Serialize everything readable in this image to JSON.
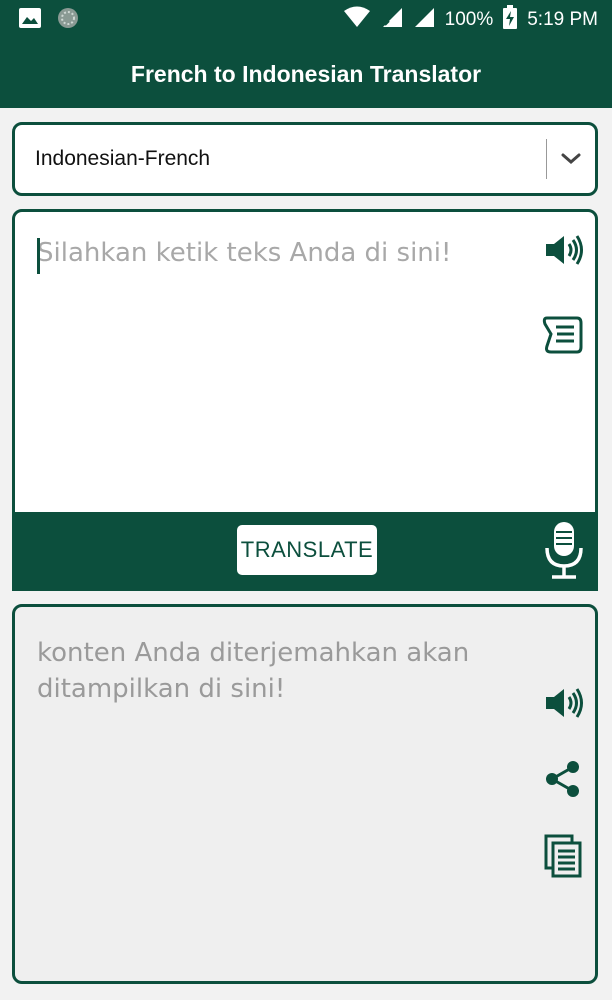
{
  "status_bar": {
    "battery": "100%",
    "time": "5:19 PM",
    "icons": [
      "image-icon",
      "app-icon",
      "wifi-icon",
      "signal-icon",
      "signal-icon",
      "battery-charging-icon"
    ]
  },
  "app_bar": {
    "title": "French to Indonesian Translator"
  },
  "language_select": {
    "selected": "Indonesian-French",
    "icon": "chevron-down-icon"
  },
  "input": {
    "placeholder": "Silahkan ketik teks Anda di sini!",
    "value": "",
    "icons": [
      "speaker-icon",
      "scroll-icon",
      "microphone-icon"
    ]
  },
  "translate_button": {
    "label": "TRANSLATE"
  },
  "output": {
    "placeholder": "konten Anda diterjemahkan akan ditampilkan di sini!",
    "icons": [
      "speaker-icon",
      "share-icon",
      "copy-icon"
    ]
  },
  "colors": {
    "primary": "#0c4f3d",
    "background": "#f2f2f2",
    "placeholder": "#a8a8a8"
  }
}
